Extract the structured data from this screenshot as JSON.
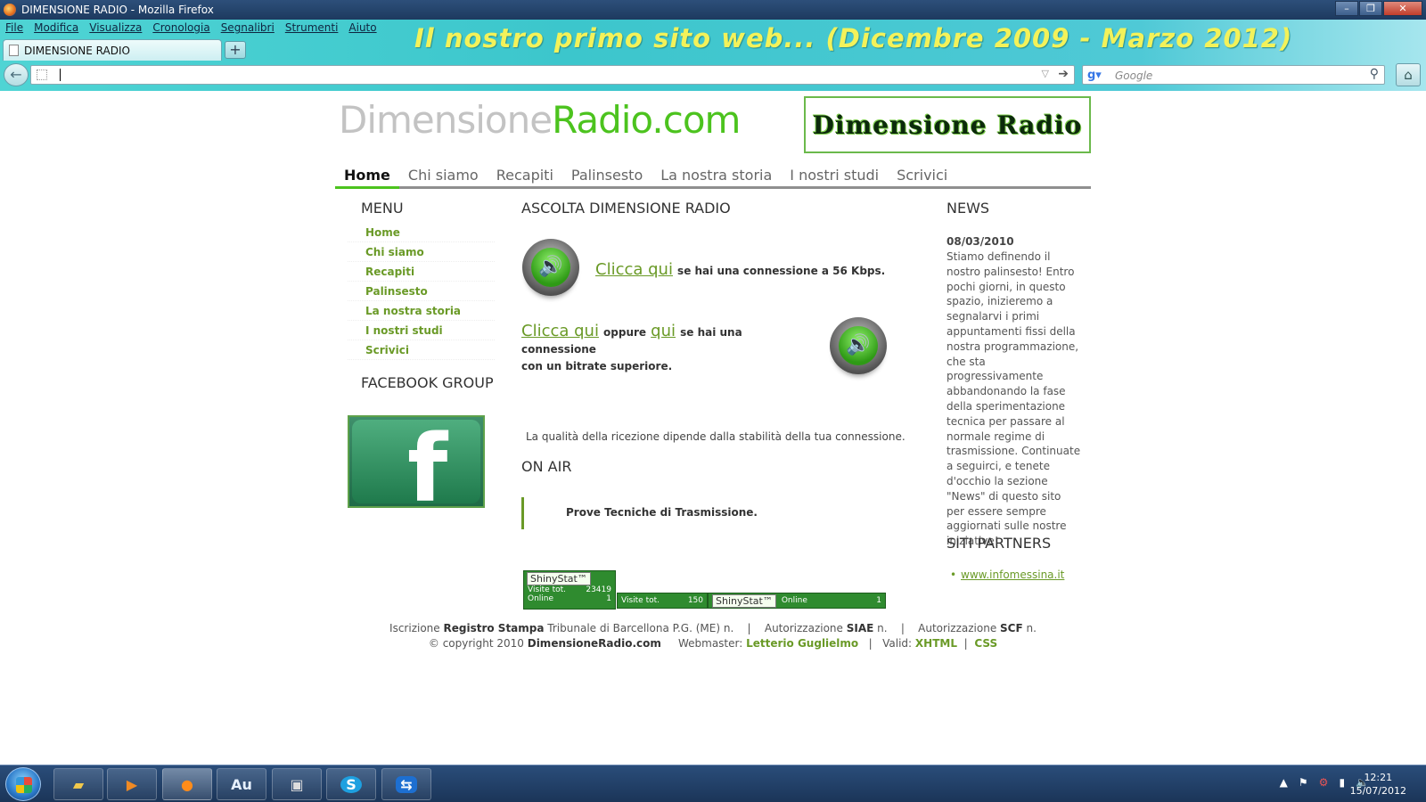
{
  "window": {
    "title": "DIMENSIONE RADIO - Mozilla Firefox"
  },
  "browser": {
    "menu": [
      "File",
      "Modifica",
      "Visualizza",
      "Cronologia",
      "Segnalibri",
      "Strumenti",
      "Aiuto"
    ],
    "banner": "Il nostro primo sito web... (Dicembre 2009 - Marzo 2012)",
    "tab_label": "DIMENSIONE RADIO",
    "new_tab": "+",
    "url_value": "",
    "search_placeholder": "Google"
  },
  "site": {
    "logo_grey": "Dimensione",
    "logo_green": "Radio.com",
    "logo_box": "Dimensione Radio",
    "nav": [
      "Home",
      "Chi siamo",
      "Recapiti",
      "Palinsesto",
      "La nostra storia",
      "I nostri studi",
      "Scrivici"
    ],
    "menu_title": "MENU",
    "menu": [
      "Home",
      "Chi siamo",
      "Recapiti",
      "Palinsesto",
      "La nostra storia",
      "I nostri studi",
      "Scrivici"
    ],
    "facebook_title": "FACEBOOK GROUP",
    "listen_title": "ASCOLTA DIMENSIONE RADIO",
    "listen1_link": "Clicca qui",
    "listen1_text": "se hai una connessione a 56 Kbps.",
    "listen2_link": "Clicca qui",
    "listen2_or": "oppure",
    "listen2_link2": "qui",
    "listen2_text_a": "se hai una connessione",
    "listen2_text_b": "con un bitrate superiore.",
    "quality_note": "La qualità della ricezione dipende dalla stabilità della tua connessione.",
    "onair_title": "ON AIR",
    "onair_text": "Prove Tecniche di Trasmissione.",
    "stats": {
      "brand": "ShinyStat™",
      "visits_label": "Visite tot.",
      "visits_a": "23419",
      "online_label": "Online",
      "online_a": "1",
      "visits_b": "150",
      "online_b": "1"
    },
    "news_title": "NEWS",
    "news_date": "08/03/2010",
    "news_body": "Stiamo definendo il nostro palinsesto! Entro pochi giorni, in questo spazio, inizieremo a segnalarvi i primi appuntamenti fissi della nostra programmazione, che sta progressivamente abbandonando la fase della sperimentazione tecnica per passare al normale regime di trasmissione. Continuate a seguirci, e tenete d'occhio la sezione \"News\" di questo sito per essere sempre aggiornati sulle nostre iniziative!",
    "partners_title": "SITI PARTNERS",
    "partner_link": "www.infomessina.it",
    "footer": {
      "l1_a": "Iscrizione",
      "l1_b": "Registro Stampa",
      "l1_c": "Tribunale di Barcellona P.G. (ME) n.",
      "l1_sep": "|",
      "l1_d": "Autorizzazione",
      "l1_e": "SIAE",
      "l1_f": "n.",
      "l1_g": "Autorizzazione",
      "l1_h": "SCF",
      "l1_i": "n.",
      "l2_a": "© copyright 2010",
      "l2_b": "DimensioneRadio.com",
      "l2_c": "Webmaster:",
      "l2_d": "Letterio Guglielmo",
      "l2_e": "Valid:",
      "l2_f": "XHTML",
      "l2_g": "CSS"
    }
  },
  "taskbar": {
    "apps": [
      "explorer-icon",
      "media-player-icon",
      "firefox-icon",
      "Au",
      "audio-recorder-icon",
      "skype-icon",
      "teamviewer-icon"
    ],
    "time": "12:21",
    "date": "15/07/2012"
  }
}
